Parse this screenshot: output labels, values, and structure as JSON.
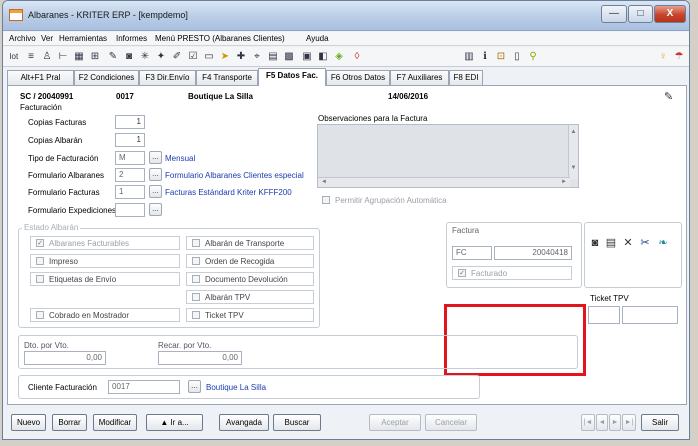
{
  "window": {
    "title": "Albaranes - KRITER ERP - [kempdemo]",
    "btn_min": "—",
    "btn_max": "□",
    "btn_close": "X"
  },
  "menu": [
    "Archivo",
    "Ver",
    "Herramientas",
    "Informes",
    "Menú PRESTO (Albaranes Clientes)",
    "Ayuda"
  ],
  "tabs": [
    "Alt+F1 Pral",
    "F2 Condiciones",
    "F3 Dir.Envío",
    "F4 Transporte",
    "F5 Datos Fac.",
    "F6 Otros Datos",
    "F7 Auxiliares",
    "F8 EDI"
  ],
  "active_tab": "F5 Datos Fac.",
  "header": {
    "document": "SC / 20040991",
    "code": "0017",
    "client": "Boutique La Silla",
    "date": "14/06/2016"
  },
  "facturacion": {
    "title": "Facturación",
    "copias_facturas_label": "Copias Facturas",
    "copias_facturas": "1",
    "copias_albaran_label": "Copias Albarán",
    "copias_albaran": "1",
    "tipo_label": "Tipo de Facturación",
    "tipo_code": "M",
    "tipo_link": "Mensual",
    "form_albaranes_label": "Formulario Albaranes",
    "form_albaranes_code": "2",
    "form_albaranes_link": "Formulario Albaranes Clientes especial",
    "form_facturas_label": "Formulario Facturas",
    "form_facturas_code": "1",
    "form_facturas_link": "Facturas Estándard Kriter KFFF200",
    "form_expediciones_label": "Formulario Expediciones",
    "form_expediciones_code": "",
    "dots": "..."
  },
  "observaciones": {
    "label": "Observaciones para la Factura",
    "agrupacion": "Permitir Agrupación Automática",
    "arrow_up": "▲",
    "arrow_down": "▼",
    "arrow_left": "◄",
    "arrow_right": "►"
  },
  "estado": {
    "title": "Estado Albarán",
    "left": [
      {
        "label": "Albaranes Facturables",
        "checked": true
      },
      {
        "label": "Impreso",
        "checked": false
      },
      {
        "label": "Etiquetas de Envío",
        "checked": false
      },
      {
        "label": "Cobrado en Mostrador",
        "checked": false
      }
    ],
    "right": [
      {
        "label": "Albarán de Transporte",
        "checked": false
      },
      {
        "label": "Orden de Recogida",
        "checked": false
      },
      {
        "label": "Documento Devolución",
        "checked": false
      },
      {
        "label": "Albarán TPV",
        "checked": false
      },
      {
        "label": "Ticket TPV",
        "checked": false
      }
    ],
    "check_mark": "✓"
  },
  "factura": {
    "title": "Factura",
    "serie": "FC",
    "numero": "20040418",
    "facturado_label": "Facturado",
    "facturado": true
  },
  "ticket_tpv": {
    "label": "Ticket TPV",
    "left_value": "",
    "right_value": ""
  },
  "descuentos": {
    "dto_label": "Dto. por Vto.",
    "dto_value": "0,00",
    "recar_label": "Recar. por Vto.",
    "recar_value": "0,00"
  },
  "cliente_facturacion": {
    "label": "Cliente Facturación",
    "code": "0017",
    "name": "Boutique La Silla"
  },
  "buttons": {
    "nuevo": "Nuevo",
    "borrar": "Borrar",
    "modificar": "Modificar",
    "ira": "▲ Ir a...",
    "avangada": "Avangada",
    "buscar": "Buscar",
    "aceptar": "Aceptar",
    "cancelar": "Cancelar",
    "salir": "Salir",
    "nav_first": "|◄",
    "nav_prev": "◄",
    "nav_next": "►",
    "nav_last": "►|"
  }
}
